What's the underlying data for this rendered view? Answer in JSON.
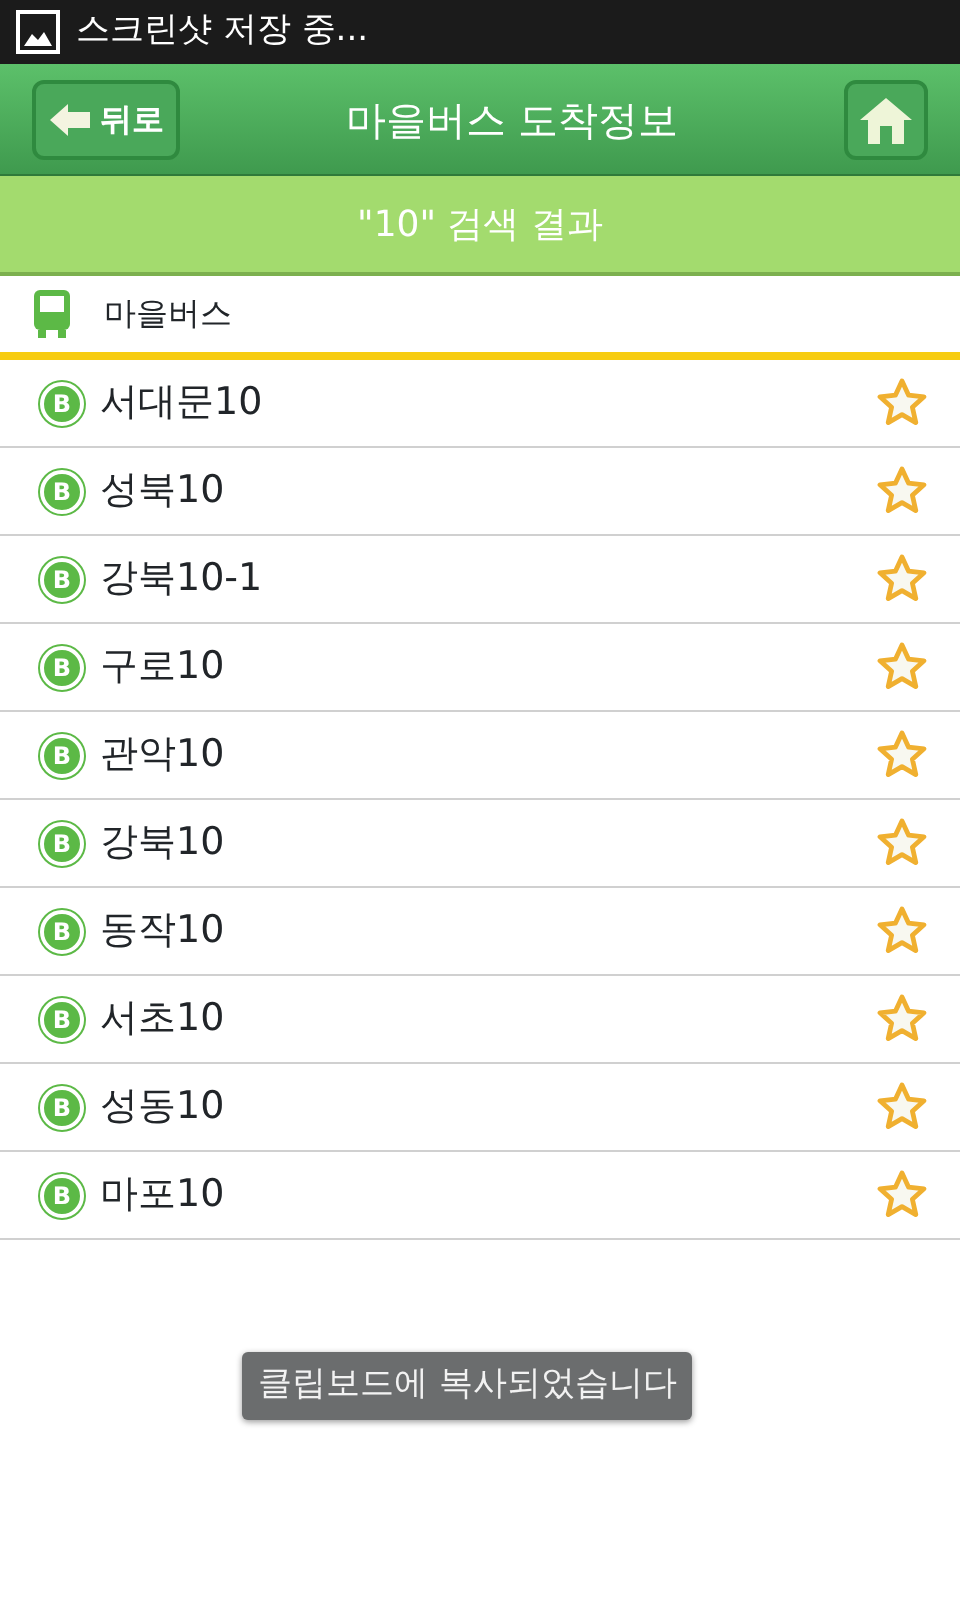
{
  "status_bar": {
    "notification": "스크린샷 저장 중..."
  },
  "header": {
    "back_button": "뒤로",
    "title": "마을버스 도착정보"
  },
  "search_result": "\"10\" 검색 결과",
  "category": {
    "label": "마을버스"
  },
  "routes": [
    {
      "badge": "B",
      "name": "서대문10",
      "favorite": false
    },
    {
      "badge": "B",
      "name": "성북10",
      "favorite": false
    },
    {
      "badge": "B",
      "name": "강북10-1",
      "favorite": false
    },
    {
      "badge": "B",
      "name": "구로10",
      "favorite": false
    },
    {
      "badge": "B",
      "name": "관악10",
      "favorite": false
    },
    {
      "badge": "B",
      "name": "강북10",
      "favorite": false
    },
    {
      "badge": "B",
      "name": "동작10",
      "favorite": false
    },
    {
      "badge": "B",
      "name": "서초10",
      "favorite": false
    },
    {
      "badge": "B",
      "name": "성동10",
      "favorite": false
    },
    {
      "badge": "B",
      "name": "마포10",
      "favorite": false
    }
  ],
  "toast": "클립보드에 복사되었습니다"
}
